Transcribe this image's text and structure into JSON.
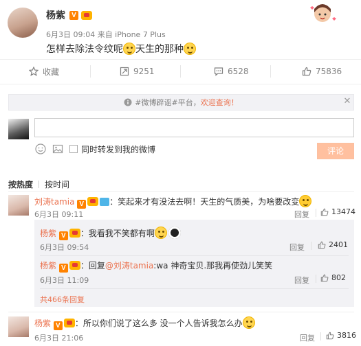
{
  "post": {
    "author": "杨紫",
    "meta": "6月3日 09:04 来自 iPhone 7 Plus",
    "text_part1": "怎样去除法令纹呢",
    "text_part2": "天生的那种"
  },
  "actions": {
    "favorite": "收藏",
    "repost_count": "9251",
    "comment_count": "6528",
    "like_count": "75836"
  },
  "notice": {
    "text": "#微博辟谣#平台，",
    "link": "欢迎查询！"
  },
  "composer": {
    "input_value": "",
    "repost_label": "同时转发到我的微博",
    "submit_label": "评论"
  },
  "sort": {
    "hot": "按热度",
    "time": "按时间"
  },
  "comments": [
    {
      "author": "刘涛tamia",
      "text": "：笑起来才有没法去啊！天生的气质美，为啥要改变",
      "time": "6月3日 09:11",
      "reply_label": "回复",
      "likes": "13474"
    }
  ],
  "replies": [
    {
      "author": "杨紫",
      "text": "：我看我不笑都有啊",
      "time": "6月3日 09:54",
      "reply_label": "回复",
      "likes": "2401"
    },
    {
      "author": "杨紫",
      "text_prefix": "：回复",
      "mention": "@刘涛tamia",
      "text": ":wa 神奇宝贝.那我再使劲儿笑笑",
      "time": "6月3日 11:09",
      "reply_label": "回复",
      "likes": "802"
    }
  ],
  "more_replies": "共466条回复",
  "comment2": {
    "author": "杨紫",
    "text": "：所以你们说了这么多 没一个人告诉我怎么办",
    "time": "6月3日 21:06",
    "reply_label": "回复",
    "likes": "3816"
  },
  "colors": {
    "accent": "#eb7350",
    "submit_bg": "#ffc09f",
    "notice_link": "#eb7350"
  }
}
